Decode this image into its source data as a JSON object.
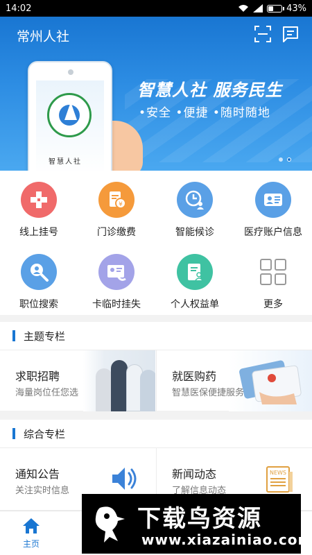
{
  "status_bar": {
    "time": "14:02",
    "battery": "43%",
    "battery_level": 0.43
  },
  "header": {
    "title": "常州人社",
    "scan_icon": "scan-icon",
    "message_icon": "message-icon"
  },
  "banner": {
    "slogan": "智慧人社 服务民生",
    "tagline": "•安全 •便捷 •随时随地",
    "phone_text": "智慧人社",
    "page_count": 2,
    "active_page": 2
  },
  "services": [
    {
      "label": "线上挂号",
      "icon": "hospital-cross-icon",
      "color": "#f06a6a"
    },
    {
      "label": "门诊缴费",
      "icon": "bill-yuan-icon",
      "color": "#f59a3b"
    },
    {
      "label": "智能候诊",
      "icon": "clock-person-icon",
      "color": "#5aa0e6"
    },
    {
      "label": "医疗账户信息",
      "icon": "id-card-icon",
      "color": "#5aa0e6"
    },
    {
      "label": "职位搜索",
      "icon": "search-person-icon",
      "color": "#5aa0e6"
    },
    {
      "label": "卡临时挂失",
      "icon": "card-phone-icon",
      "color": "#a3a3e8"
    },
    {
      "label": "个人权益单",
      "icon": "document-person-icon",
      "color": "#3fc2a2"
    },
    {
      "label": "更多",
      "icon": "grid-more-icon",
      "color": "#ffffff"
    }
  ],
  "topic_section": {
    "title": "主题专栏",
    "cards": [
      {
        "title": "求职招聘",
        "subtitle": "海量岗位任您选"
      },
      {
        "title": "就医购药",
        "subtitle": "智慧医保便捷服务"
      }
    ]
  },
  "general_section": {
    "title": "综合专栏",
    "cards": [
      {
        "title": "通知公告",
        "subtitle": "关注实时信息",
        "icon": "speaker-icon"
      },
      {
        "title": "新闻动态",
        "subtitle": "了解信息动态",
        "icon": "news-icon",
        "icon_text": "NEWS"
      }
    ]
  },
  "tabbar": {
    "home_label": "主页",
    "accent": "#1976d2"
  },
  "watermark": {
    "name": "下载鸟资源",
    "url": "www.xiazainiao.com"
  },
  "colors": {
    "primary": "#1976d2",
    "banner_light": "#4aa8f0"
  }
}
